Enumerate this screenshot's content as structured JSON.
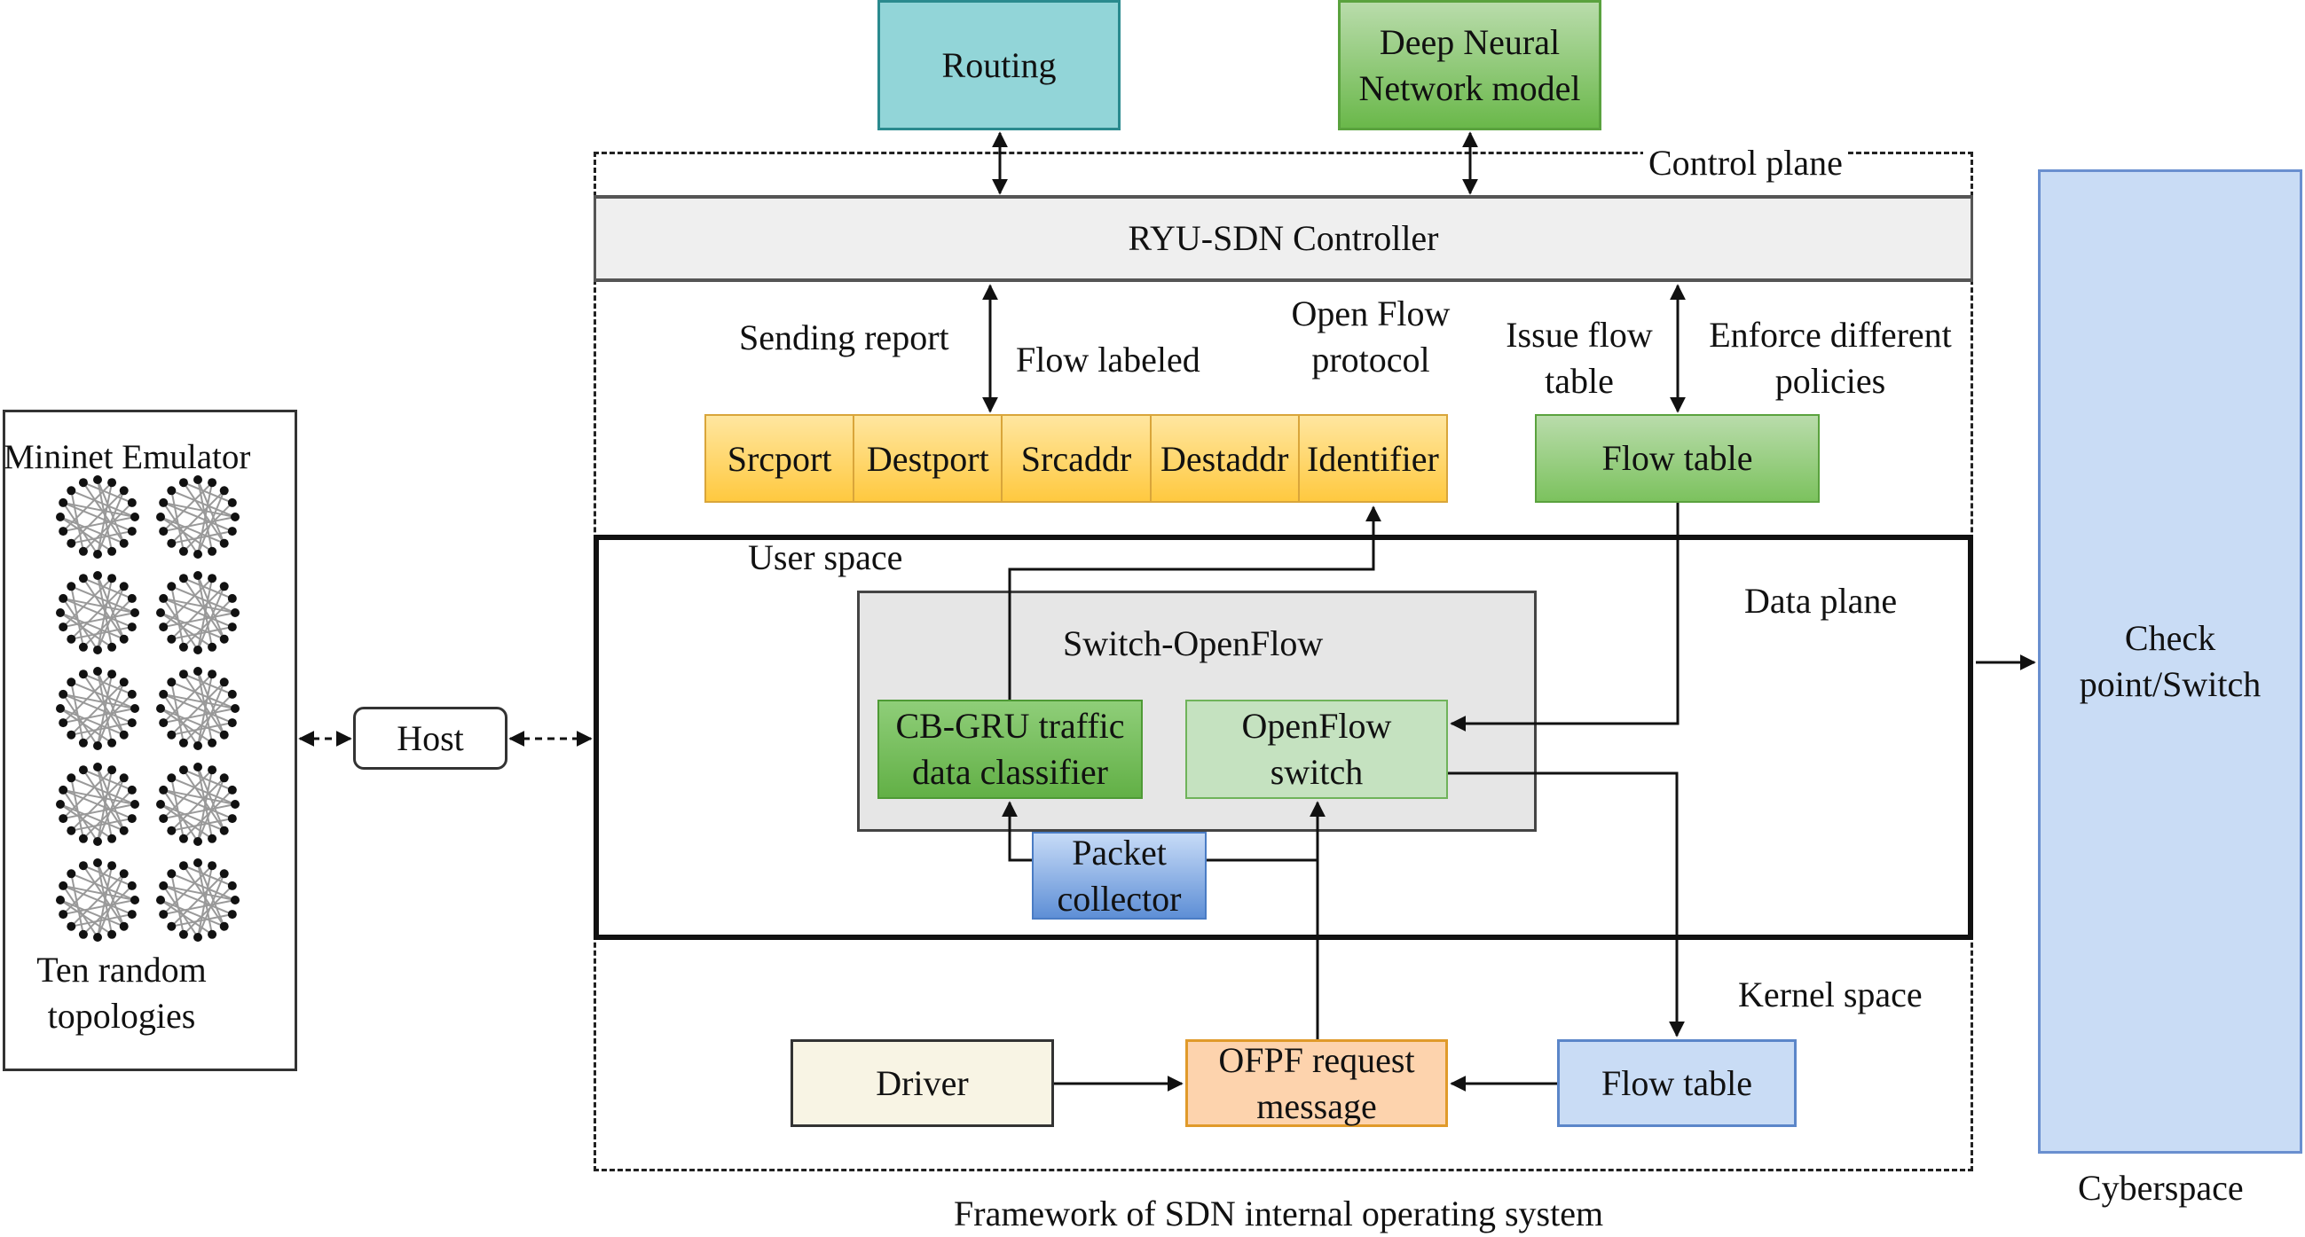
{
  "title": "Framework of SDN internal operating system",
  "colors": {
    "routing": "#92d5d8",
    "dnn": "#7cc25e",
    "controller": "#efefef",
    "packet_fields": "#ffd966",
    "flow_table_green": "#97cf7f",
    "cbgru": "#6fba57",
    "openflow_switch": "#c5e2c0",
    "packet_collector": "#7ea6e0",
    "driver": "#f8f4e4",
    "ofpf": "#fdd3ad",
    "flow_table_blue": "#c9dcf5",
    "checkpoint": "#c9dcf5",
    "switch_container": "#e6e6e6"
  },
  "top": {
    "routing": "Routing",
    "dnn": [
      "Deep Neural",
      "Network model"
    ]
  },
  "control_plane": {
    "label": "Control plane",
    "controller": "RYU-SDN Controller",
    "sending_report": "Sending report",
    "flow_labeled": "Flow labeled",
    "openflow_protocol": [
      "Open Flow",
      "protocol"
    ],
    "issue_flow_table": [
      "Issue flow",
      "table"
    ],
    "enforce_policies": [
      "Enforce different",
      "policies"
    ],
    "packet_fields": [
      "Srcport",
      "Destport",
      "Srcaddr",
      "Destaddr",
      "Identifier"
    ],
    "flow_table": "Flow table"
  },
  "data_plane": {
    "label": "Data plane",
    "user_space": "User space",
    "switch_openflow": "Switch-OpenFlow",
    "cbgru": [
      "CB-GRU traffic",
      "data classifier"
    ],
    "openflow_switch": [
      "OpenFlow",
      "switch"
    ],
    "packet_collector": [
      "Packet",
      "collector"
    ]
  },
  "kernel": {
    "label": "Kernel space",
    "driver": "Driver",
    "ofpf": [
      "OFPF request",
      "message"
    ],
    "flow_table": "Flow table"
  },
  "mininet": {
    "title": "Mininet Emulator",
    "caption": [
      "Ten random",
      "topologies"
    ],
    "topology_count": 10
  },
  "host": "Host",
  "cyberspace": {
    "checkpoint": [
      "Check",
      "point/Switch"
    ],
    "label": "Cyberspace"
  }
}
